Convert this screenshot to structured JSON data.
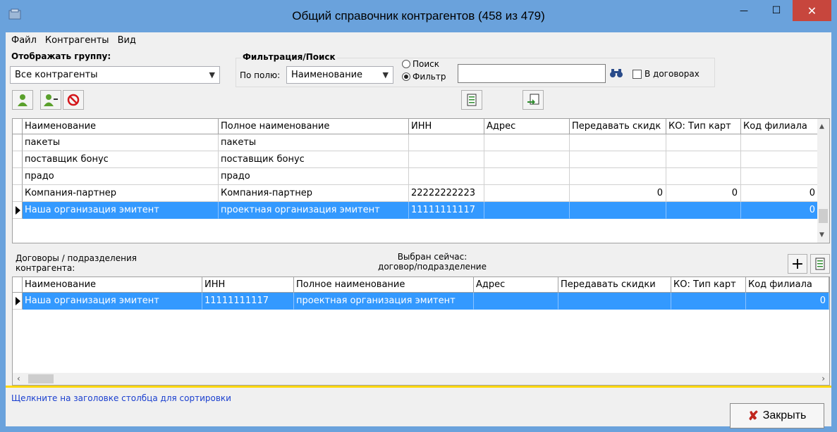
{
  "window": {
    "title": "Общий справочник контрагентов (458 из 479)",
    "min_glyph": "—",
    "max_glyph": "☐",
    "close_glyph": "✕"
  },
  "menu": [
    "Файл",
    "Контрагенты",
    "Вид"
  ],
  "group": {
    "label": "Отображать группу:",
    "value": "Все контрагенты"
  },
  "filter": {
    "title": "Фильтрация/Поиск",
    "by_field_label": "По полю:",
    "field_value": "Наименование",
    "radio_search": "Поиск",
    "radio_filter": "Фильтр",
    "selected_mode": "Фильтр",
    "query": "",
    "in_contracts_label": "В договорах",
    "in_contracts_checked": false
  },
  "main_grid": {
    "columns": [
      "Наименование",
      "Полное наименование",
      "ИНН",
      "Адрес",
      "Передавать скидк",
      "КО: Тип карт",
      "Код филиала"
    ],
    "rows": [
      [
        "пакеты",
        "пакеты",
        "",
        "",
        "",
        "",
        ""
      ],
      [
        "поставщик бонус",
        "поставщик бонус",
        "",
        "",
        "",
        "",
        ""
      ],
      [
        "прадо",
        "прадо",
        "",
        "",
        "",
        "",
        ""
      ],
      [
        "Компания-партнер",
        "Компания-партнер",
        "22222222223",
        "",
        "0",
        "0",
        "0"
      ],
      [
        "Наша организация эмитент",
        "проектная организация  эмитент",
        "11111111117",
        "",
        "",
        "",
        "0"
      ]
    ],
    "selected_row": 4
  },
  "sub_section": {
    "label_line1": "Договоры / подразделения",
    "label_line2": "контрагента:",
    "selected_now_line1": "Выбран сейчас:",
    "selected_now_line2": "договор/подразделение",
    "add_glyph": "+"
  },
  "sub_grid": {
    "columns": [
      "Наименование",
      "ИНН",
      "Полное наименование",
      "Адрес",
      "Передавать скидки",
      "КО: Тип карт",
      "Код филиала"
    ],
    "rows": [
      [
        "Наша организация эмитент",
        "11111111117",
        "проектная организация  эмитент",
        "",
        "",
        "",
        "0"
      ]
    ]
  },
  "status": {
    "hint": "Щелкните на заголовке столбца для сортировки"
  },
  "close_button": {
    "glyph": "✘",
    "label": "Закрыть"
  },
  "colors": {
    "selection": "#3399ff",
    "titlebar": "#6aa2dc",
    "close": "#c7463d",
    "status_border": "#ffd700",
    "hint_text": "#1a3fcf"
  }
}
